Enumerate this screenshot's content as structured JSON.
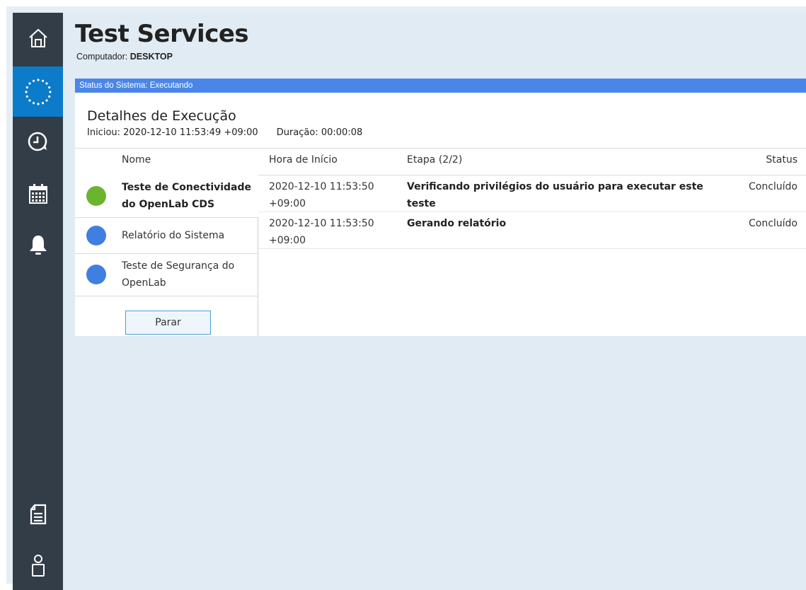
{
  "app": {
    "title": "Test Services",
    "computer_label": "Computador:",
    "computer_name": "DESKTOP"
  },
  "sidebar": {
    "items": [
      {
        "name": "home",
        "icon": "home-icon",
        "active": false
      },
      {
        "name": "execution",
        "icon": "spinner-icon",
        "active": true
      },
      {
        "name": "history",
        "icon": "history-clock-icon",
        "active": false
      },
      {
        "name": "schedule",
        "icon": "calendar-icon",
        "active": false
      },
      {
        "name": "notifications",
        "icon": "bell-icon",
        "active": false
      },
      {
        "name": "reports",
        "icon": "document-icon",
        "active": false
      },
      {
        "name": "user",
        "icon": "user-icon",
        "active": false
      }
    ]
  },
  "status_bar": {
    "text": "Status do Sistema: Executando",
    "color": "#4a86e8"
  },
  "details": {
    "title": "Detalhes de Execução",
    "started": "Iniciou: 2020-12-10 11:53:49 +09:00",
    "duration": "Duração: 00:00:08"
  },
  "columns": {
    "name": "Nome",
    "start_time": "Hora de Início",
    "step": "Etapa (2/2)",
    "status": "Status"
  },
  "tests": [
    {
      "label": "Teste de Conectividade do OpenLab CDS",
      "status_color": "#6ab42f",
      "selected": true
    },
    {
      "label": "Relatório do Sistema",
      "status_color": "#3f7fe0",
      "selected": false
    },
    {
      "label": "Teste de Segurança do OpenLab",
      "status_color": "#3f7fe0",
      "selected": false
    }
  ],
  "steps": [
    {
      "start": "2020-12-10 11:53:50 +09:00",
      "step": "Verificando privilégios do usuário para executar este teste",
      "status": "Concluído"
    },
    {
      "start": "2020-12-10 11:53:50 +09:00",
      "step": "Gerando relatório",
      "status": "Concluído"
    }
  ],
  "actions": {
    "stop_label": "Parar"
  }
}
